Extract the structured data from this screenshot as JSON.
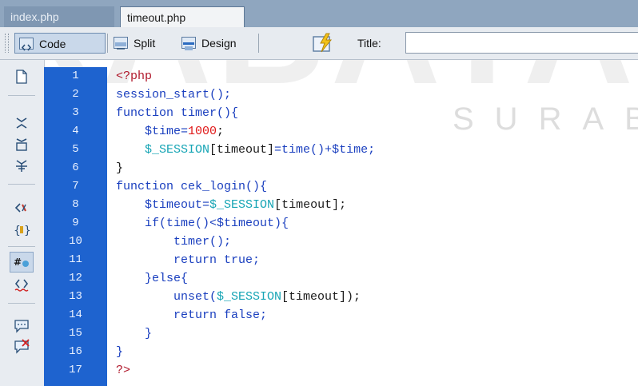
{
  "tabs": [
    "index.php",
    "timeout.php"
  ],
  "toolbar": {
    "code_label": "Code",
    "split_label": "Split",
    "design_label": "Design",
    "title_label": "Title:",
    "title_value": ""
  },
  "watermark": {
    "text": "SURABAYA"
  },
  "line_numbers": [
    "1",
    "2",
    "3",
    "4",
    "5",
    "6",
    "7",
    "8",
    "9",
    "10",
    "11",
    "12",
    "13",
    "14",
    "15",
    "16",
    "17"
  ],
  "code": {
    "l1": "<?php",
    "l2": "session_start();",
    "l3a": "function ",
    "l3b": "timer(){",
    "l4a": "    $time=",
    "l4b": "1000",
    "l4c": ";",
    "l5a": "    $_SESSION",
    "l5b": "[timeout]",
    "l5c": "=time()+",
    "l5d": "$time;",
    "l6": "}",
    "l7a": "function ",
    "l7b": "cek_login(){",
    "l8a": "    $timeout",
    "l8b": "=",
    "l8c": "$_SESSION",
    "l8d": "[timeout];",
    "l9": "    if(time()<$timeout){",
    "l10": "        timer();",
    "l11": "        return true;",
    "l12": "    }else{",
    "l13a": "        unset(",
    "l13b": "$_SESSION",
    "l13c": "[timeout]);",
    "l14": "        return false;",
    "l15": "    }",
    "l16": "}",
    "l17": "?>"
  },
  "colors": {
    "gutter": "#1e63cf",
    "tabbar": "#8fa6bf",
    "keyword": "#1a3fbf",
    "php_tag": "#b0182b",
    "number": "#e01818",
    "session": "#17a5b5"
  },
  "icons": [
    "new-document-icon",
    "collapse-full-tag-icon",
    "collapse-selection-icon",
    "expand-all-icon",
    "select-parent-tag-icon",
    "balance-braces-icon",
    "line-numbers-icon",
    "highlight-invalid-code-icon",
    "apply-comment-icon",
    "remove-comment-icon"
  ]
}
